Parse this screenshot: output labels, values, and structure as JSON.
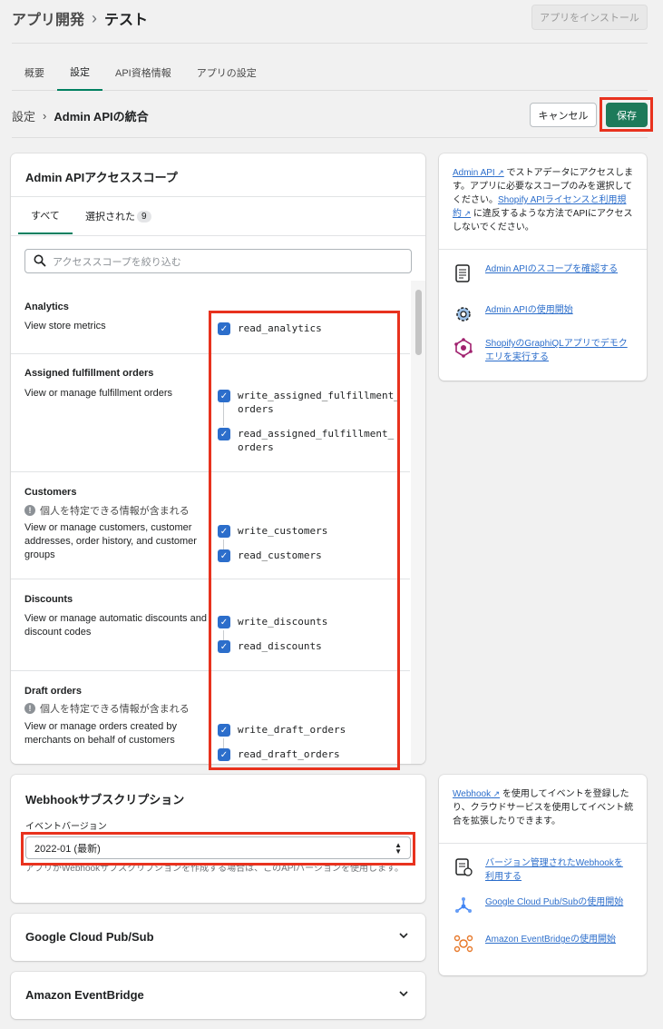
{
  "header": {
    "parent": "アプリ開発",
    "current": "テスト",
    "install_label": "アプリをインストール"
  },
  "tabs": [
    "概要",
    "設定",
    "API資格情報",
    "アプリの設定"
  ],
  "sub_header": {
    "parent": "設定",
    "current": "Admin APIの統合",
    "cancel_label": "キャンセル",
    "save_label": "保存"
  },
  "scopes_card": {
    "title": "Admin APIアクセススコープ",
    "tab_all": "すべて",
    "tab_selected": "選択された",
    "selected_count": "9",
    "search_placeholder": "アクセススコープを絞り込む",
    "pii_warning": "個人を特定できる情報が含まれる",
    "sections": [
      {
        "title": "Analytics",
        "desc": "View store metrics",
        "scopes": [
          "read_analytics"
        ]
      },
      {
        "title": "Assigned fulfillment orders",
        "desc": "View or manage fulfillment orders",
        "scopes": [
          "write_assigned_fulfillment_",
          "orders",
          "read_assigned_fulfillment_",
          "orders"
        ]
      },
      {
        "title": "Customers",
        "desc": "View or manage customers, customer addresses, order history, and customer groups",
        "scopes": [
          "write_customers",
          "read_customers"
        ]
      },
      {
        "title": "Discounts",
        "desc": "View or manage automatic discounts and discount codes",
        "scopes": [
          "write_discounts",
          "read_discounts"
        ]
      },
      {
        "title": "Draft orders",
        "desc": "View or manage orders created by merchants on behalf of customers",
        "scopes": [
          "write_draft_orders",
          "read_draft_orders"
        ]
      }
    ]
  },
  "side_admin": {
    "link_admin_api": "Admin API",
    "intro_text": "でストアデータにアクセスします。アプリに必要なスコープのみを選択してください。",
    "link_license": "Shopify APIライセンスと利用規約",
    "outro_text": "に違反するような方法でAPIにアクセスしないでください。",
    "links": [
      "Admin APIのスコープを確認する",
      "Admin APIの使用開始",
      "ShopifyのGraphiQLアプリでデモクエリを実行する"
    ]
  },
  "webhook_card": {
    "title": "Webhookサブスクリプション",
    "field_label": "イベントバージョン",
    "selected_version": "2022-01 (最新)",
    "help": "アプリがWebhookサブスクリプションを作成する場合は、このAPIバージョンを使用します。"
  },
  "side_webhook": {
    "link_webhook": "Webhook",
    "text": "を使用してイベントを登録したり、クラウドサービスを使用してイベント統合を拡張したりできます。",
    "links": [
      "バージョン管理されたWebhookを利用する",
      "Google Cloud Pub/Subの使用開始",
      "Amazon EventBridgeの使用開始"
    ]
  },
  "accordions": [
    "Google Cloud Pub/Sub",
    "Amazon EventBridge"
  ],
  "colors": {
    "accent": "#008060",
    "save": "#1d7a5a",
    "checkbox": "#2c6ecb",
    "highlight": "#e8321e",
    "link": "#2c6ecb"
  }
}
